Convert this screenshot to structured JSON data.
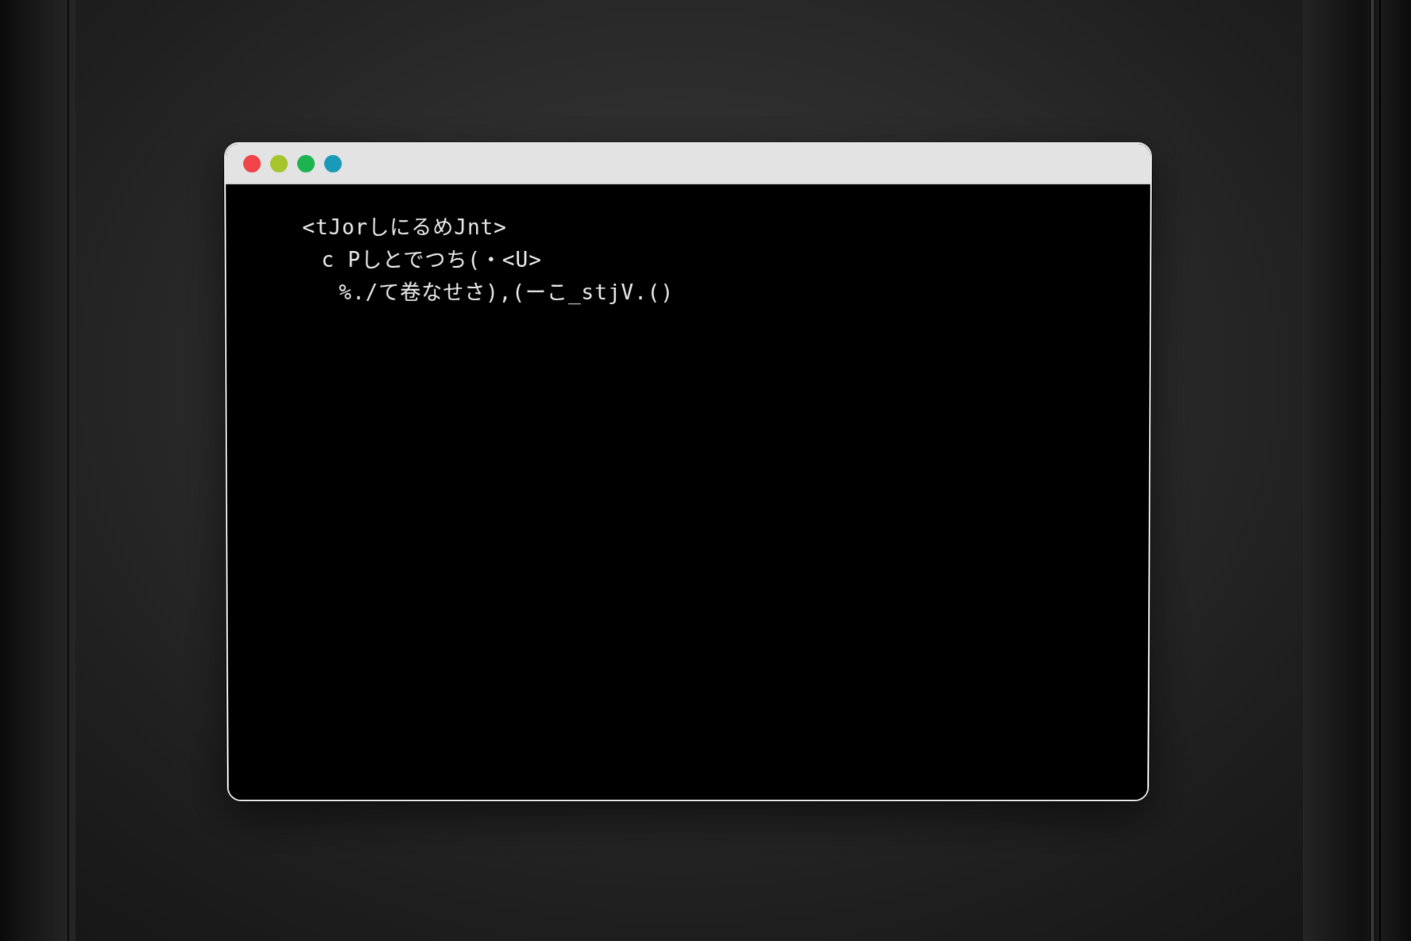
{
  "window": {
    "controls": [
      {
        "name": "close-button",
        "color": "#f0434a"
      },
      {
        "name": "minimize-button",
        "color": "#a5c52a"
      },
      {
        "name": "maximize-button",
        "color": "#1db351"
      },
      {
        "name": "extra-button",
        "color": "#1a9ab8"
      }
    ]
  },
  "terminal": {
    "lines": [
      "<tJorしにるめJnt>",
      "c Pしとでつち(・<U>",
      "%./て卷なせさ),(ーこ_stjV.()"
    ]
  }
}
